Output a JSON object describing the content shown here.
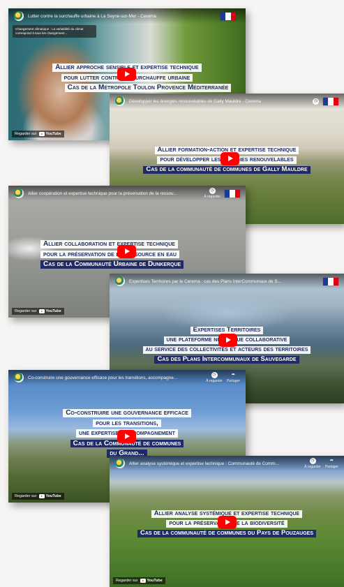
{
  "watch_on": "Regarder sur",
  "youtube": "YouTube",
  "later_label": "À regarder",
  "share_label": "Partager",
  "brand_colors": {
    "caption_blue": "#1c2a5c",
    "caption_dark_bg": "#1f2a66",
    "play_red": "#ff0000"
  },
  "videos": [
    {
      "title": "Lutter contre la surchauffe urbaine à La Seyne-sur-Mer - Cerema",
      "info": "Changement climatique : La variabilité du climat correspond à tous les changement...",
      "captions": [
        "Allier approche sensible et expertise technique",
        "pour lutter contre la surchauffe urbaine",
        "Cas de la Métropole Toulon Provence Méditerranée"
      ]
    },
    {
      "title": "Développer les énergies renouvelables de Gally Mauldre - Cerema",
      "captions": [
        "Allier formation-action et expertise technique",
        "pour développer les énergies renouvelables",
        "Cas de la communauté de communes de Gally Mauldre"
      ]
    },
    {
      "title": "Allier coopération et expertise technique pour la préservation de la ressou...",
      "captions": [
        "Allier collaboration et expertise technique",
        "pour la préservation de la ressource en eau",
        "Cas de la Communauté Urbaine de Dunkerque"
      ]
    },
    {
      "title": "Expertises Territoires par le Cerema : cas des Plans InterCommunaux de S...",
      "captions": [
        "Expertises Territoires",
        "une plateforme numérique collaborative",
        "au service des collectivités et acteurs des territoires",
        "Cas des Plans Intercommunaux de Sauvegarde"
      ]
    },
    {
      "title": "Co-construire une gouvernance efficace pour les transitions, accompagne...",
      "captions": [
        "Co-construire une gouvernance efficace",
        "pour les transitions,",
        "une expertise d'accompagnement",
        "Cas de la Communauté de communes",
        "du Grand..."
      ]
    },
    {
      "title": "Allier analyse systémique et expertise technique : Communauté de Comm...",
      "captions": [
        "Allier analyse systémique et expertise technique",
        "pour la préservation de la biodiversité",
        "Cas de la communauté de communes du Pays de Pouzauges"
      ]
    }
  ]
}
